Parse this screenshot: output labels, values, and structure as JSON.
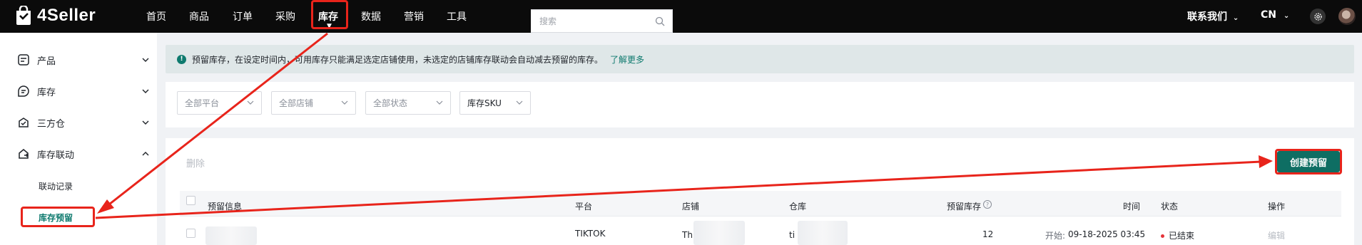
{
  "brand": {
    "name": "4Seller"
  },
  "nav": {
    "items": [
      "首页",
      "商品",
      "订单",
      "采购",
      "库存",
      "数据",
      "营销",
      "工具"
    ],
    "contact": "联系我们",
    "lang": "CN"
  },
  "sidebar": {
    "groups": [
      {
        "label": "产品",
        "icon": "product-icon"
      },
      {
        "label": "库存",
        "icon": "inventory-icon"
      },
      {
        "label": "三方仓",
        "icon": "warehouse-icon"
      },
      {
        "label": "库存联动",
        "icon": "sync-icon"
      }
    ],
    "sub_items": [
      "联动记录",
      "库存预留"
    ]
  },
  "notice": {
    "text": "预留库存，在设定时间内，可用库存只能满足选定店铺使用，未选定的店铺库存联动会自动减去预留的库存。",
    "link": "了解更多"
  },
  "filters": {
    "platform": "全部平台",
    "store": "全部店铺",
    "status": "全部状态",
    "sku_type": "库存SKU",
    "search_placeholder": "搜索"
  },
  "actions": {
    "delete": "删除",
    "create": "创建预留"
  },
  "table": {
    "headers": {
      "info": "预留信息",
      "platform": "平台",
      "store": "店铺",
      "warehouse": "仓库",
      "reserved": "预留库存",
      "time": "时间",
      "status": "状态",
      "ops": "操作"
    },
    "rows": [
      {
        "platform": "TIKTOK",
        "store_prefix": "Th",
        "warehouse_prefix": "ti",
        "reserved": "12",
        "start_label": "开始:",
        "start": "09-18-2025 03:45",
        "status": "已结束",
        "op": "编辑"
      }
    ]
  },
  "colors": {
    "accent": "#0e7a6e",
    "annotation": "#e8241b",
    "topbar": "#0b0b0b"
  }
}
